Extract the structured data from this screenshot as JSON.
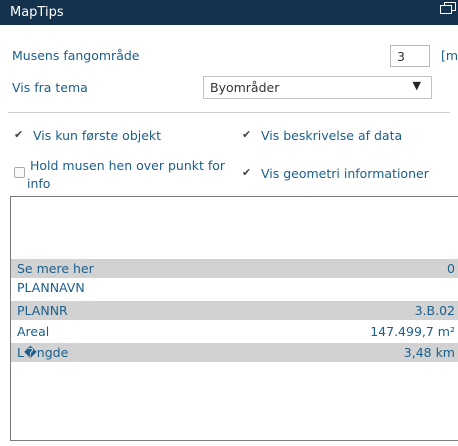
{
  "title": "MapTips",
  "title_icon": "restore-window-icon",
  "capture": {
    "label": "Musens fangområde",
    "value": "3",
    "unit": "[m]"
  },
  "theme": {
    "label": "Vis fra tema",
    "selected": "Byområder",
    "arrow": "▼"
  },
  "options": {
    "first_object": {
      "label": "Vis kun første objekt",
      "checked": true
    },
    "description": {
      "label": "Vis beskrivelse af data",
      "checked": true
    },
    "hover_line1": "Hold musen hen over punkt for",
    "hover_line2": "info",
    "hover_checked": false,
    "geometry": {
      "label": "Vis geometri informationer",
      "checked": true
    }
  },
  "results": [
    {
      "key": "Se mere her",
      "value": "0"
    },
    {
      "key": "PLANNAVN",
      "value": ""
    },
    {
      "key": "PLANNR",
      "value": "3.B.02"
    },
    {
      "key": "Areal",
      "value": "147.499,7 m²"
    },
    {
      "key": "L�ngde",
      "value": "3,48 km"
    }
  ]
}
